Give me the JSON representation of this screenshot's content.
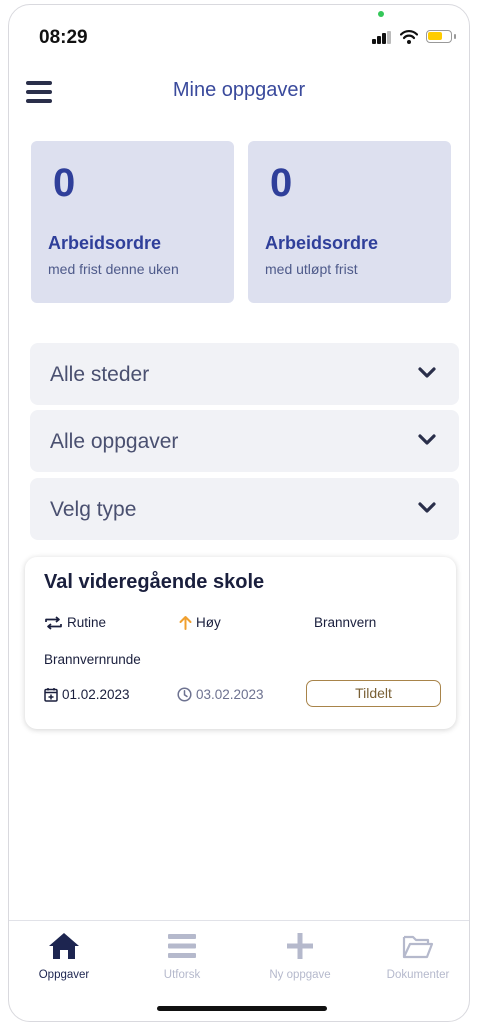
{
  "status_bar": {
    "time": "08:29"
  },
  "header": {
    "title": "Mine oppgaver",
    "menu_icon": "hamburger-menu-icon"
  },
  "stats": [
    {
      "value": "0",
      "label": "Arbeidsordre",
      "sublabel": "med frist denne uken"
    },
    {
      "value": "0",
      "label": "Arbeidsordre",
      "sublabel": "med utløpt frist"
    }
  ],
  "filters": [
    {
      "label": "Alle steder"
    },
    {
      "label": "Alle oppgaver"
    },
    {
      "label": "Velg type"
    }
  ],
  "task": {
    "title": "Val videregående skole",
    "frequency": "Rutine",
    "priority": "Høy",
    "category": "Brannvern",
    "task_type": "Brannvernrunde",
    "start_date": "01.02.2023",
    "due_date": "03.02.2023",
    "status": "Tildelt"
  },
  "bottom_nav": [
    {
      "label": "Oppgaver",
      "icon": "home-icon",
      "active": true
    },
    {
      "label": "Utforsk",
      "icon": "list-icon",
      "active": false
    },
    {
      "label": "Ny oppgave",
      "icon": "plus-icon",
      "active": false
    },
    {
      "label": "Dokumenter",
      "icon": "folder-icon",
      "active": false
    }
  ],
  "colors": {
    "accent": "#2f3f9a",
    "stat_card_bg": "#dde0ef",
    "priority_high": "#f0a030",
    "status_border": "#a8844a"
  }
}
